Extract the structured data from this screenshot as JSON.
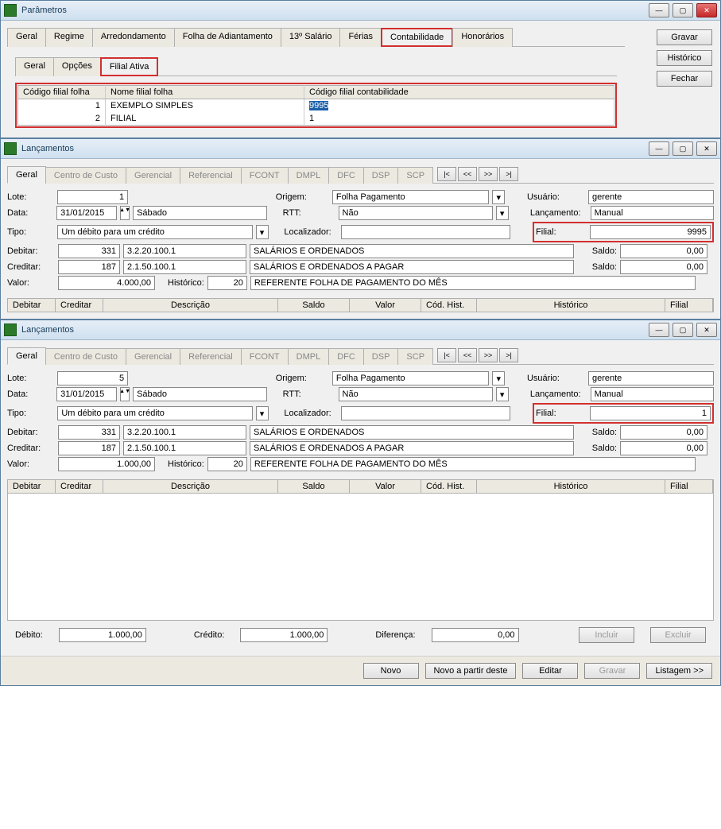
{
  "win1": {
    "title": "Parâmetros",
    "buttons": {
      "gravar": "Gravar",
      "historico": "Histórico",
      "fechar": "Fechar"
    },
    "tabs_outer": [
      "Geral",
      "Regime",
      "Arredondamento",
      "Folha de Adiantamento",
      "13º Salário",
      "Férias",
      "Contabilidade",
      "Honorários"
    ],
    "tabs_inner": [
      "Geral",
      "Opções",
      "Filial Ativa"
    ],
    "table": {
      "hdr": [
        "Código filial folha",
        "Nome filial folha",
        "Código filial contabilidade"
      ],
      "rows": [
        {
          "c": "1",
          "n": "EXEMPLO SIMPLES",
          "cc": "9995",
          "sel": true
        },
        {
          "c": "2",
          "n": "FILIAL",
          "cc": "1",
          "sel": false
        }
      ]
    }
  },
  "win2": {
    "title": "Lançamentos",
    "tabs": [
      "Geral",
      "Centro de Custo",
      "Gerencial",
      "Referencial",
      "FCONT",
      "DMPL",
      "DFC",
      "DSP",
      "SCP"
    ],
    "labels": {
      "lote": "Lote:",
      "data": "Data:",
      "tipo": "Tipo:",
      "origem": "Origem:",
      "rtt": "RTT:",
      "localiz": "Localizador:",
      "usuario": "Usuário:",
      "lanc": "Lançamento:",
      "filial": "Filial:",
      "debitar": "Debitar:",
      "creditar": "Creditar:",
      "valor": "Valor:",
      "historico": "Histórico:",
      "saldo": "Saldo:"
    },
    "lote": "1",
    "data": "31/01/2015",
    "dow": "Sábado",
    "tipo": "Um débito para um crédito",
    "origem": "Folha Pagamento",
    "rtt": "Não",
    "usuario": "gerente",
    "lanc": "Manual",
    "filial": "9995",
    "deb_n": "331",
    "deb_c": "3.2.20.100.1",
    "deb_d": "SALÁRIOS E ORDENADOS",
    "saldo1": "0,00",
    "cre_n": "187",
    "cre_c": "2.1.50.100.1",
    "cre_d": "SALÁRIOS E ORDENADOS A PAGAR",
    "saldo2": "0,00",
    "valor": "4.000,00",
    "hist_n": "20",
    "hist_t": "REFERENTE FOLHA DE PAGAMENTO DO MÊS",
    "cols": [
      "Debitar",
      "Creditar",
      "Descrição",
      "Saldo",
      "Valor",
      "Cód. Hist.",
      "Histórico",
      "Filial"
    ]
  },
  "win3": {
    "title": "Lançamentos",
    "lote": "5",
    "data": "31/01/2015",
    "dow": "Sábado",
    "tipo": "Um débito para um crédito",
    "origem": "Folha Pagamento",
    "rtt": "Não",
    "usuario": "gerente",
    "lanc": "Manual",
    "filial": "1",
    "deb_n": "331",
    "deb_c": "3.2.20.100.1",
    "deb_d": "SALÁRIOS E ORDENADOS",
    "saldo1": "0,00",
    "cre_n": "187",
    "cre_c": "2.1.50.100.1",
    "cre_d": "SALÁRIOS E ORDENADOS A PAGAR",
    "saldo2": "0,00",
    "valor": "1.000,00",
    "hist_n": "20",
    "hist_t": "REFERENTE FOLHA DE PAGAMENTO DO MÊS",
    "totals": {
      "deb_l": "Débito:",
      "deb_v": "1.000,00",
      "cre_l": "Crédito:",
      "cre_v": "1.000,00",
      "dif_l": "Diferença:",
      "dif_v": "0,00"
    },
    "btns": {
      "incluir": "Incluir",
      "excluir": "Excluir",
      "novo": "Novo",
      "novopartir": "Novo a partir deste",
      "editar": "Editar",
      "gravar": "Gravar",
      "listagem": "Listagem >>"
    }
  }
}
